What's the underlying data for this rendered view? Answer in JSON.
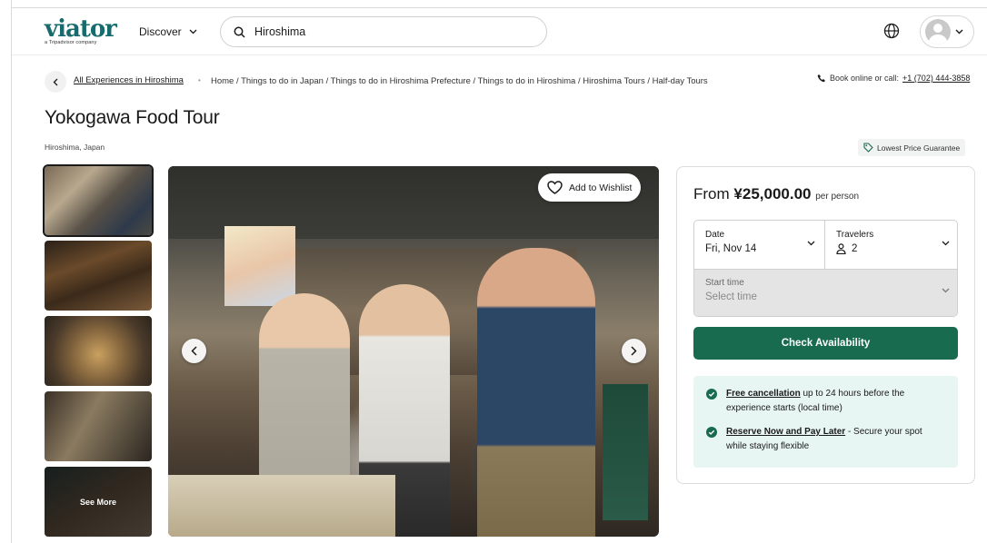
{
  "header": {
    "logo_text": "viator",
    "logo_sub": "a Tripadvisor company",
    "discover_label": "Discover",
    "search_value": "Hiroshima"
  },
  "breadcrumb": {
    "all_experiences": "All Experiences in Hiroshima",
    "separator": "•",
    "path": "Home / Things to do in Japan / Things to do in Hiroshima Prefecture / Things to do in Hiroshima / Hiroshima Tours / Half-day Tours",
    "book_online_label": "Book online or call:",
    "phone": "+1 (702) 444-3858"
  },
  "product": {
    "title": "Yokogawa Food Tour",
    "location": "Hiroshima, Japan",
    "lowest_price_label": "Lowest Price Guarantee"
  },
  "gallery": {
    "see_more_label": "See More",
    "wishlist_label": "Add to Wishlist"
  },
  "booking": {
    "price_prefix": "From",
    "price": "¥25,000.00",
    "price_suffix": "per person",
    "date_label": "Date",
    "date_value": "Fri, Nov 14",
    "travelers_label": "Travelers",
    "travelers_value": "2",
    "start_time_label": "Start time",
    "start_time_placeholder": "Select time",
    "check_button": "Check Availability",
    "benefits": [
      {
        "strong": "Free cancellation",
        "rest": " up to 24 hours before the experience starts (local time)"
      },
      {
        "strong": "Reserve Now and Pay Later",
        "rest": " - Secure your spot while staying flexible"
      }
    ]
  },
  "colors": {
    "brand": "#186b6d",
    "cta": "#186b4e",
    "benefits_bg": "#e8f6f3"
  }
}
